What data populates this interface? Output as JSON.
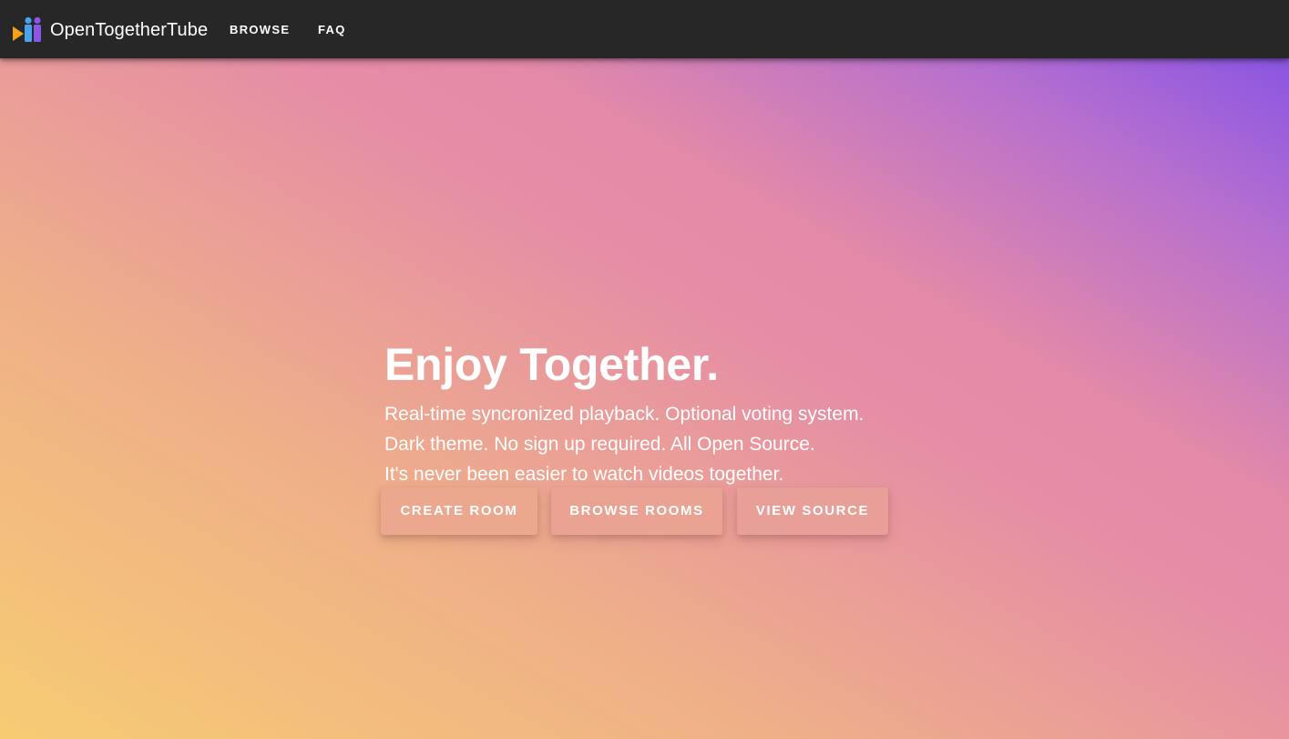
{
  "header": {
    "brand": "OpenTogetherTube",
    "logo_icon": "opentogethertube-logo-icon",
    "nav": [
      {
        "label": "BROWSE"
      },
      {
        "label": "FAQ"
      }
    ],
    "background_color": "#272727"
  },
  "hero": {
    "title": "Enjoy Together.",
    "lines": [
      "Real-time syncronized playback. Optional voting system.",
      "Dark theme. No sign up required. All Open Source.",
      "It's never been easier to watch videos together."
    ],
    "buttons": [
      {
        "label": "CREATE ROOM"
      },
      {
        "label": "BROWSE ROOMS"
      },
      {
        "label": "VIEW SOURCE"
      }
    ],
    "gradient_colors": [
      "#f6cc72",
      "#e58ca7",
      "#7c4de8"
    ]
  }
}
